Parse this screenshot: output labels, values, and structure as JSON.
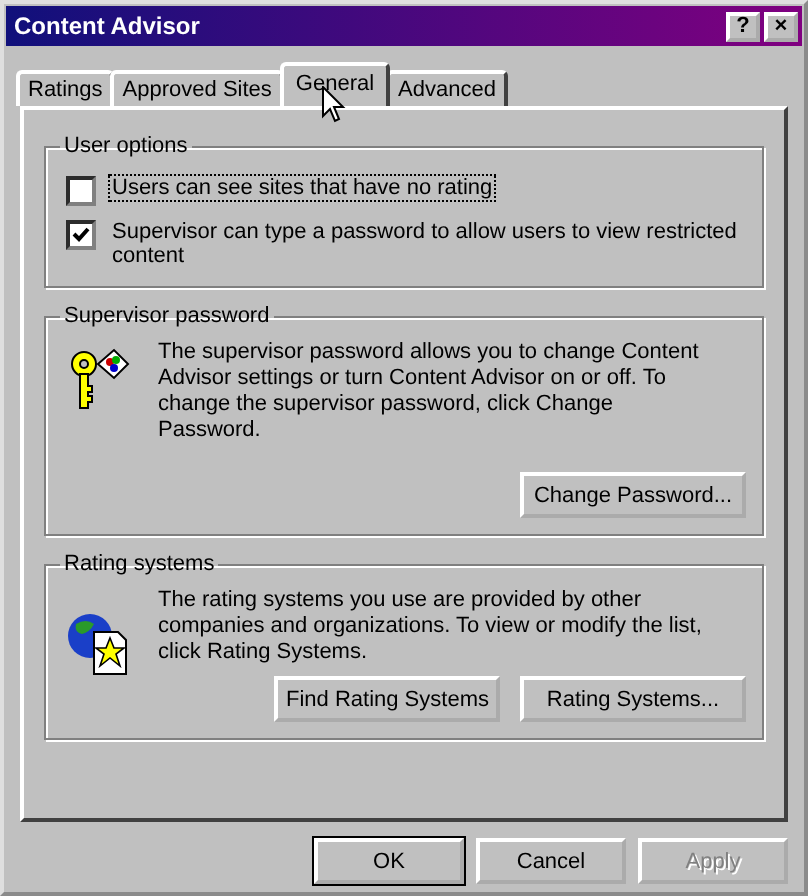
{
  "window": {
    "title": "Content Advisor"
  },
  "title_buttons": [
    "?",
    "×"
  ],
  "tabs": [
    {
      "label": "Ratings",
      "selected": false
    },
    {
      "label": "Approved Sites",
      "selected": false
    },
    {
      "label": "General",
      "selected": true
    },
    {
      "label": "Advanced",
      "selected": false
    }
  ],
  "user_options": {
    "title": "User options",
    "options": [
      {
        "label": "Users can see sites that have no rating",
        "checked": false,
        "focused": true
      },
      {
        "label": "Supervisor can type a password to allow users to view restricted content",
        "checked": true,
        "focused": false
      }
    ]
  },
  "supervisor_password": {
    "title": "Supervisor password",
    "text": "The supervisor password allows you to change Content Advisor settings or turn Content Advisor on or off. To change the supervisor password, click Change Password.",
    "buttons": [
      "Change Password..."
    ]
  },
  "rating_systems": {
    "title": "Rating systems",
    "text": "The rating systems you use are provided by other companies and organizations. To view or modify the list, click Rating Systems.",
    "buttons": [
      "Find Rating Systems",
      "Rating Systems..."
    ]
  },
  "buttons": [
    {
      "label": "OK",
      "default": true,
      "disabled": false
    },
    {
      "label": "Cancel",
      "default": false,
      "disabled": false
    },
    {
      "label": "Apply",
      "default": false,
      "disabled": true
    }
  ]
}
